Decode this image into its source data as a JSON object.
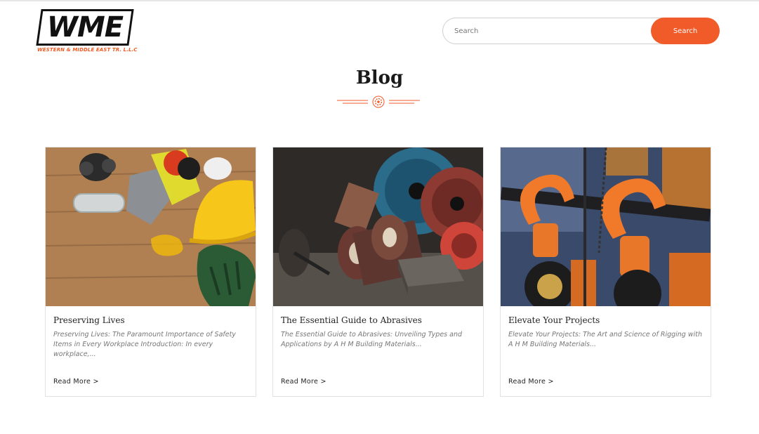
{
  "header": {
    "logo_text": "WME",
    "logo_subtitle": "WESTERN & MIDDLE EAST TR. L.L.C",
    "search_placeholder": "Search",
    "search_button_label": "Search"
  },
  "page": {
    "title": "Blog"
  },
  "posts": [
    {
      "title": "Preserving Lives",
      "excerpt": "Preserving Lives: The Paramount Importance of Safety Items in Every Workplace Introduction: In every workplace,...",
      "read_more": "Read More >",
      "image_icon": "safety-equipment-image"
    },
    {
      "title": "The Essential Guide to Abrasives",
      "excerpt": "The Essential Guide to Abrasives: Unveiling Types and Applications by A H M Building Materials...",
      "read_more": "Read More >",
      "image_icon": "abrasives-image"
    },
    {
      "title": "Elevate Your Projects",
      "excerpt": "Elevate Your Projects: The Art and Science of Rigging with A H M Building Materials...",
      "read_more": "Read More >",
      "image_icon": "rigging-hooks-image"
    }
  ],
  "colors": {
    "accent": "#f15a29",
    "text": "#222222",
    "muted": "#777777",
    "border": "#e2e2e2"
  }
}
